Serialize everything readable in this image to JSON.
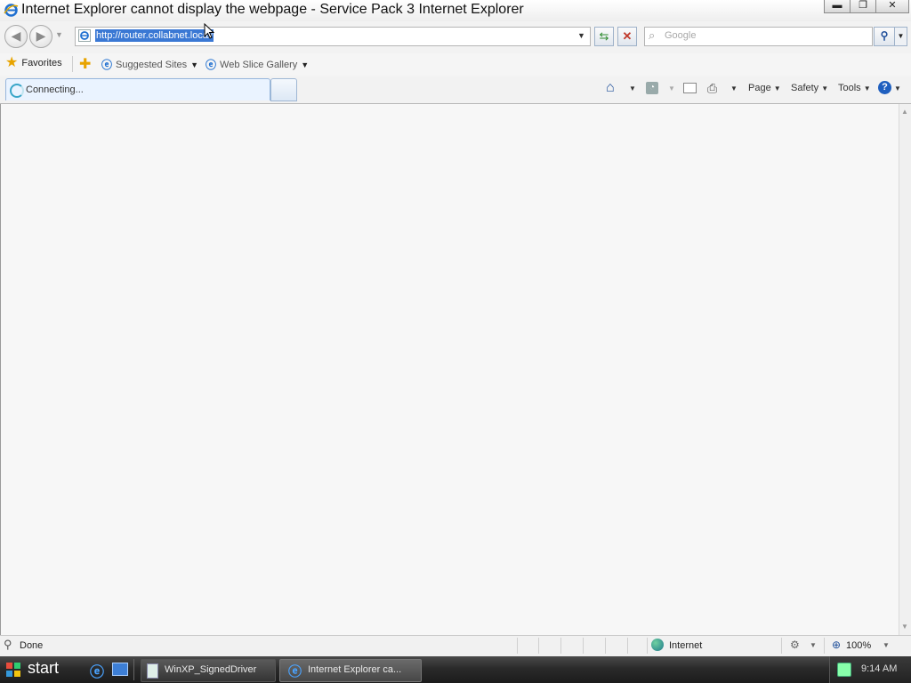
{
  "window": {
    "title": "Internet Explorer cannot display the webpage - Service Pack 3 Internet Explorer",
    "minimize_glyph": "▬",
    "restore_glyph": "❐",
    "close_glyph": "✕"
  },
  "navbar": {
    "back_glyph": "◀",
    "forward_glyph": "▶",
    "address_url": "http://router.collabnet.local/",
    "search_placeholder": "Google"
  },
  "favorites_bar": {
    "favorites_label": "Favorites",
    "suggested_sites_label": "Suggested Sites",
    "web_slice_gallery_label": "Web Slice Gallery"
  },
  "tabs": {
    "active_tab_label": "Connecting..."
  },
  "command_bar": {
    "page_label": "Page",
    "safety_label": "Safety",
    "tools_label": "Tools",
    "help_glyph": "?"
  },
  "status_bar": {
    "status_text": "Done",
    "zone_label": "Internet",
    "zoom_label": "100%"
  },
  "taskbar": {
    "start_label": "start",
    "tasks": [
      {
        "label": "WinXP_SignedDriver"
      },
      {
        "label": "Internet Explorer ca..."
      }
    ],
    "clock": "9:14 AM"
  },
  "colors": {
    "accent": "#3a78d4",
    "ie_blue": "#1f6fd0",
    "close_red": "#c0392b",
    "refresh_green": "#2e8b2e"
  }
}
